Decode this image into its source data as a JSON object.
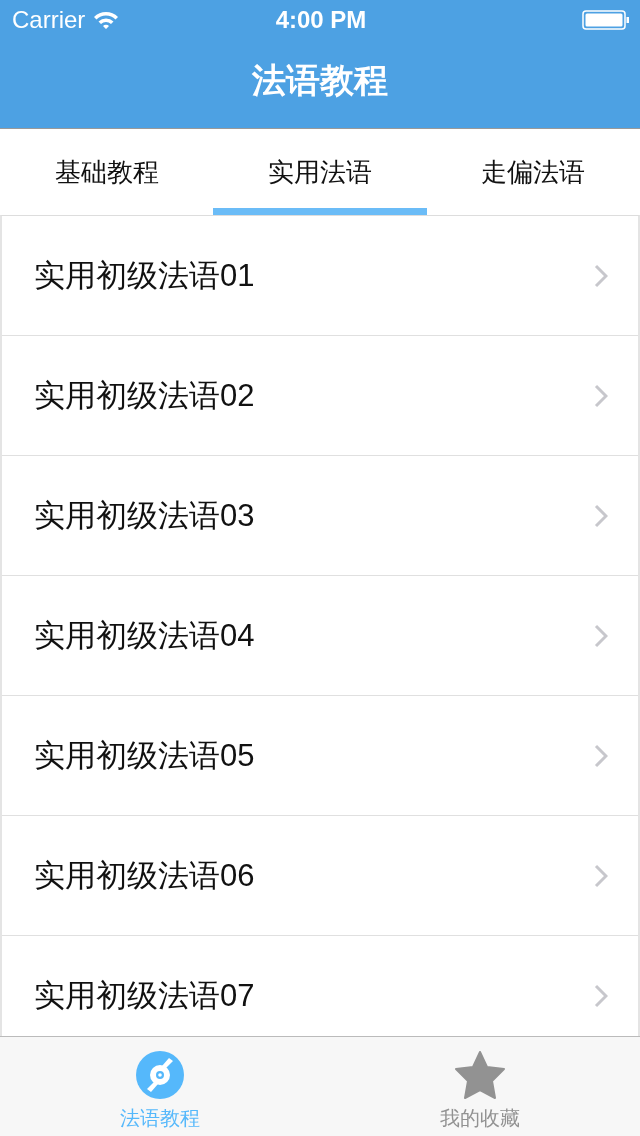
{
  "status_bar": {
    "carrier": "Carrier",
    "time": "4:00 PM"
  },
  "nav": {
    "title": "法语教程"
  },
  "tabs": [
    {
      "label": "基础教程",
      "selected": false
    },
    {
      "label": "实用法语",
      "selected": true
    },
    {
      "label": "走偏法语",
      "selected": false
    }
  ],
  "list": {
    "items": [
      "实用初级法语01",
      "实用初级法语02",
      "实用初级法语03",
      "实用初级法语04",
      "实用初级法语05",
      "实用初级法语06",
      "实用初级法语07"
    ]
  },
  "tab_bar": [
    {
      "label": "法语教程",
      "kind": "disc",
      "selected": true
    },
    {
      "label": "我的收藏",
      "kind": "star",
      "selected": false
    }
  ]
}
